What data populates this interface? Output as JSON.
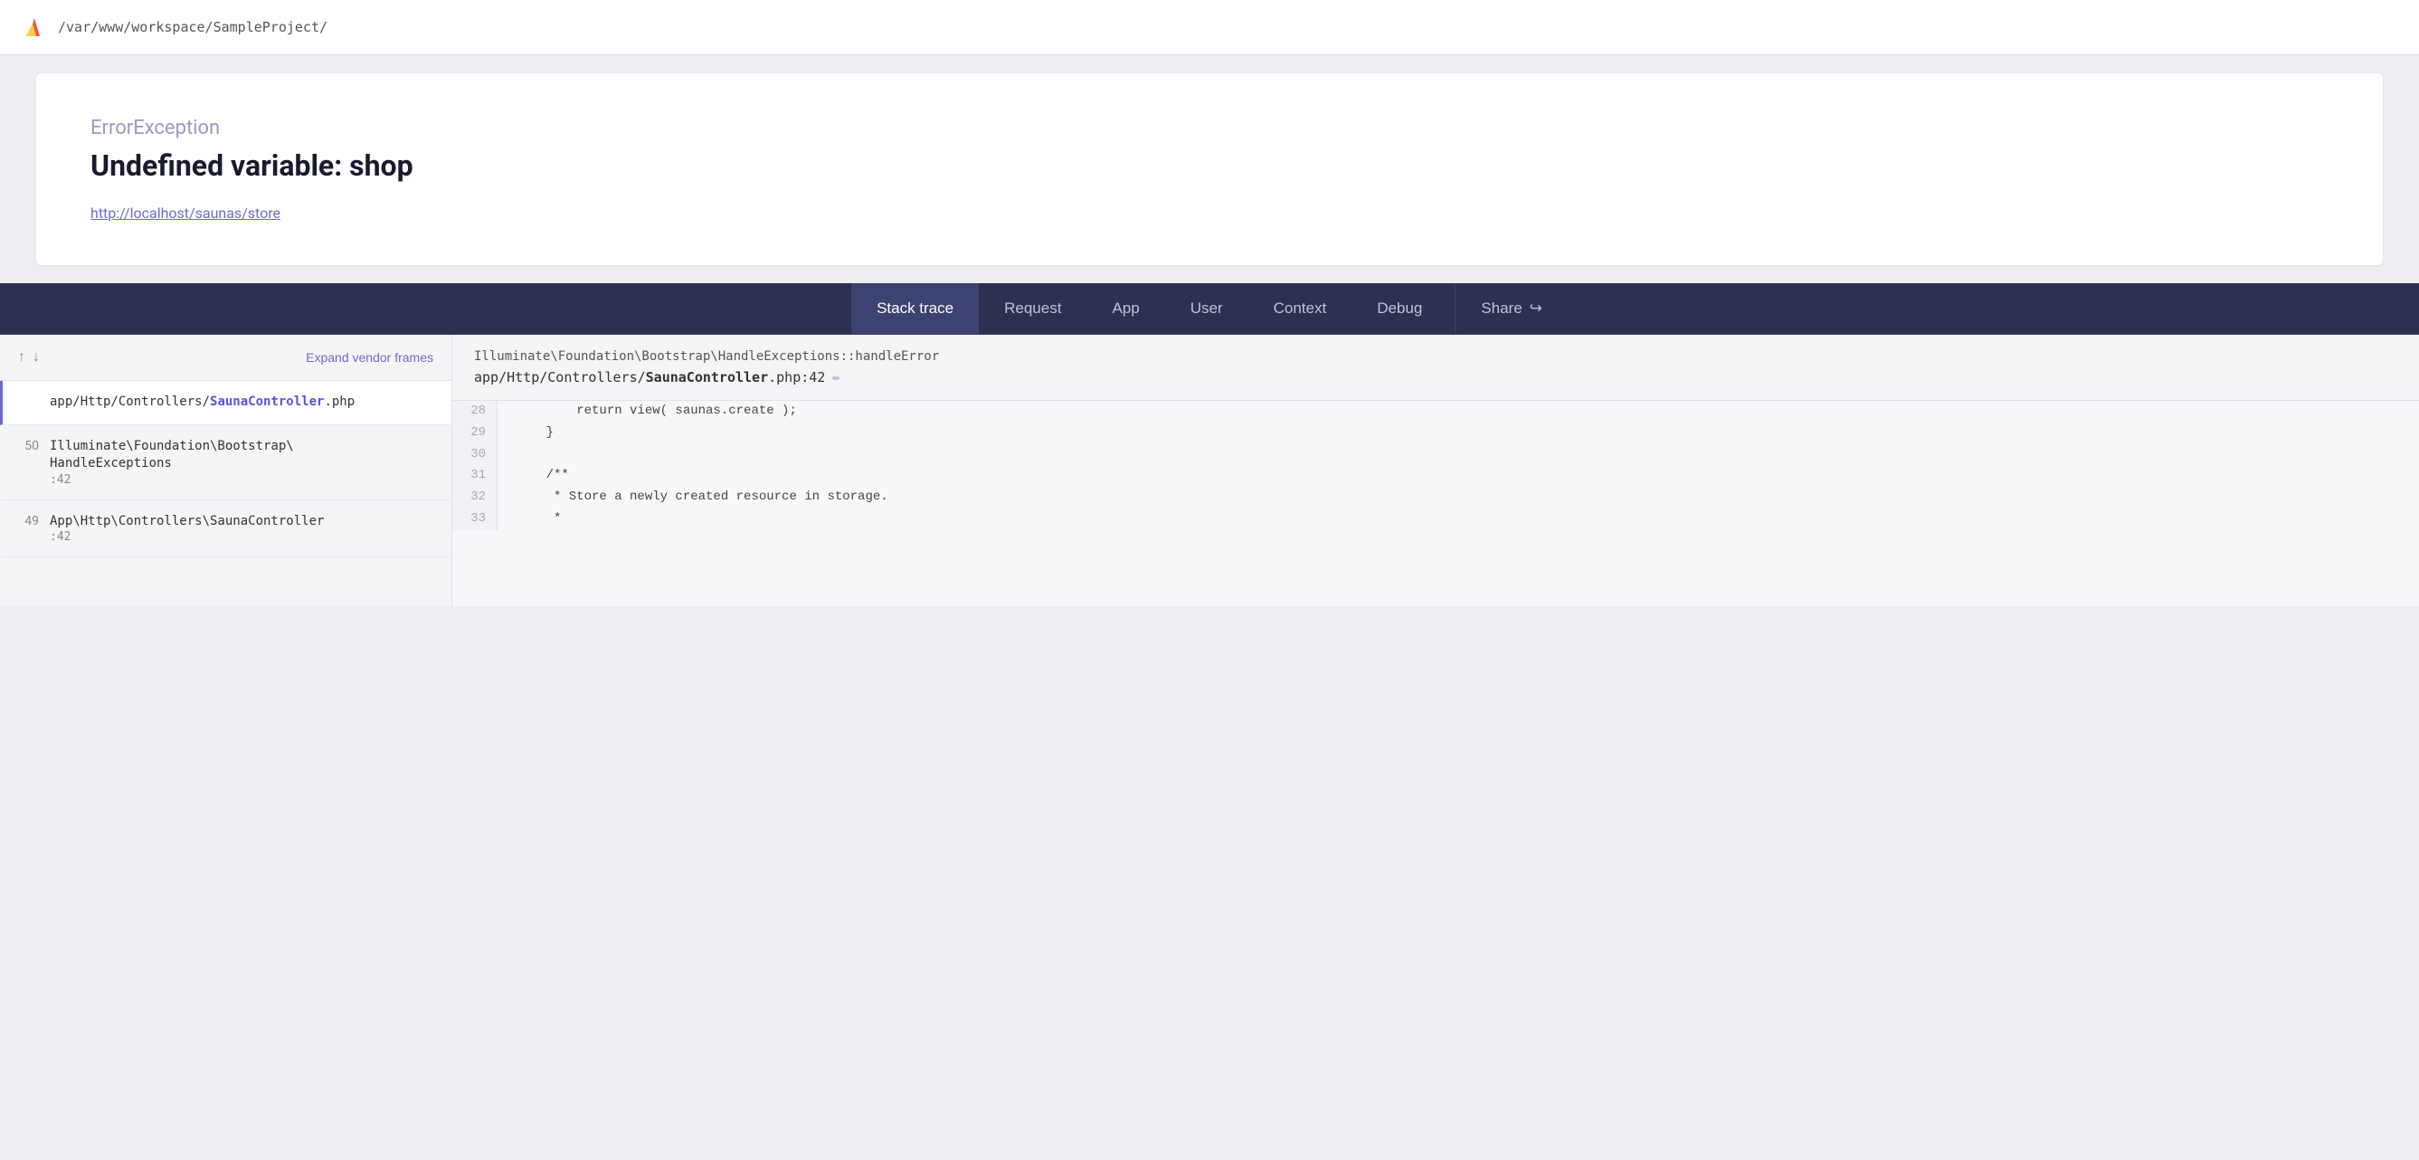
{
  "browser": {
    "path": "/var/www/workspace/SampleProject/"
  },
  "error": {
    "type": "ErrorException",
    "message": "Undefined variable: shop",
    "url": "http://localhost/saunas/store"
  },
  "tabs": {
    "items": [
      {
        "label": "Stack trace",
        "active": true
      },
      {
        "label": "Request",
        "active": false
      },
      {
        "label": "App",
        "active": false
      },
      {
        "label": "User",
        "active": false
      },
      {
        "label": "Context",
        "active": false
      },
      {
        "label": "Debug",
        "active": false
      },
      {
        "label": "Share",
        "active": false
      }
    ]
  },
  "stack": {
    "controls": {
      "up_label": "↑",
      "down_label": "↓",
      "expand_label": "Expand vendor frames"
    },
    "frames": [
      {
        "number": "",
        "path": "app/Http/Controllers/SaunaController.php",
        "highlight": "SaunaController",
        "line": "",
        "active": true
      },
      {
        "number": "50",
        "path": "Illuminate\\Foundation\\Bootstrap\\HandleExceptions",
        "highlight": "",
        "line": ":42",
        "active": false
      },
      {
        "number": "49",
        "path": "App\\Http\\Controllers\\SaunaController",
        "highlight": "",
        "line": ":42",
        "active": false
      }
    ]
  },
  "code": {
    "header_class": "Illuminate\\Foundation\\Bootstrap\\HandleExceptions::handleError",
    "header_file_prefix": "app/Http/Controllers/",
    "header_file_bold": "SaunaController",
    "header_file_suffix": ".php:42",
    "lines": [
      {
        "number": "28",
        "content": "        return view( saunas.create );",
        "active": false
      },
      {
        "number": "29",
        "content": "    }",
        "active": false
      },
      {
        "number": "30",
        "content": "",
        "active": false
      },
      {
        "number": "31",
        "content": "    /**",
        "active": false
      },
      {
        "number": "32",
        "content": "     * Store a newly created resource in storage.",
        "active": false
      },
      {
        "number": "33",
        "content": "     *",
        "active": false
      }
    ]
  }
}
